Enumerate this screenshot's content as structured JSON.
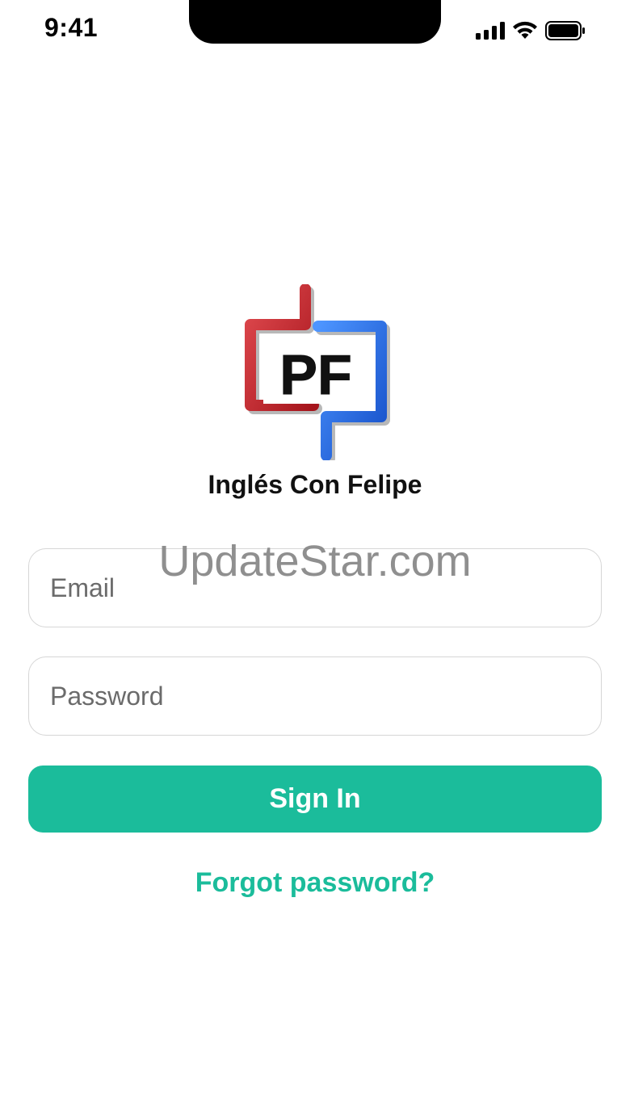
{
  "status_bar": {
    "time": "9:41",
    "signal_icon": "cellular-signal-icon",
    "wifi_icon": "wifi-icon",
    "battery_icon": "battery-icon"
  },
  "logo": {
    "text": "PF",
    "colors": {
      "red": "#c8232b",
      "blue": "#1f6ff0"
    }
  },
  "app_name": "Inglés Con Felipe",
  "watermark": "UpdateStar.com",
  "form": {
    "email_placeholder": "Email",
    "password_placeholder": "Password",
    "signin_label": "Sign In",
    "forgot_label": "Forgot password?"
  },
  "colors": {
    "accent": "#1bbc9b",
    "text": "#111111",
    "border": "#d6d6d6"
  }
}
